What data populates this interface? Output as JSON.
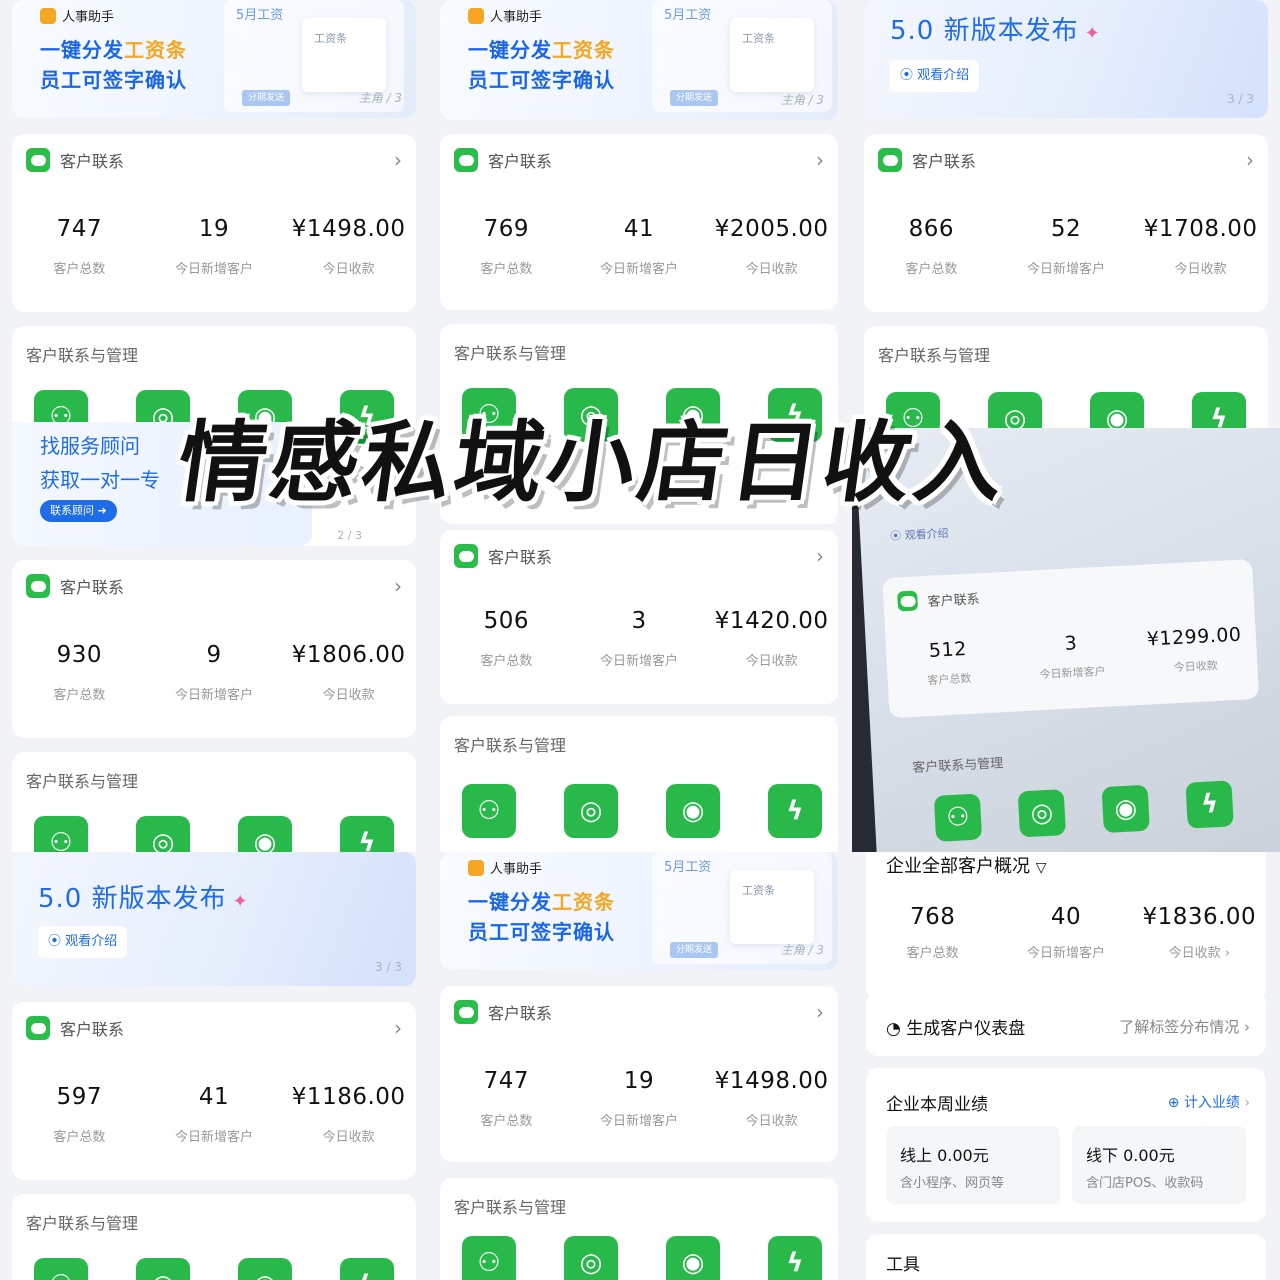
{
  "overlay": {
    "title": "情感私域小店日收入"
  },
  "labels": {
    "customer_link": "客户联系",
    "customer_mgmt": "客户联系与管理",
    "total": "客户总数",
    "new_today": "今日新增客户",
    "revenue_today": "今日收款"
  },
  "hr_banner": {
    "tag": "人事助手",
    "line1_a": "一键分发",
    "line1_b": "工资条",
    "line2": "员工可签字确认",
    "may_salary": "5月工资",
    "slip": "工资条",
    "send_btn": "分期发送",
    "page": "主角 / 3"
  },
  "v5_banner": {
    "title": "5.0 新版本发布",
    "sparkle": "✦",
    "watch": "观看介绍",
    "page": "3 / 3"
  },
  "advisor_banner": {
    "line1": "找服务顾问",
    "line2": "获取一对一专",
    "btn": "联系顾问",
    "page": "2 / 3"
  },
  "cards": {
    "c1": {
      "total": "747",
      "new": "19",
      "rev": "¥1498.00"
    },
    "c2": {
      "total": "769",
      "new": "41",
      "rev": "¥2005.00"
    },
    "c3": {
      "total": "866",
      "new": "52",
      "rev": "¥1708.00"
    },
    "c4": {
      "total": "930",
      "new": "9",
      "rev": "¥1806.00"
    },
    "c5": {
      "total": "506",
      "new": "3",
      "rev": "¥1420.00"
    },
    "c6": {
      "total": "512",
      "new": "3",
      "rev": "¥1299.00"
    },
    "c7": {
      "total": "597",
      "new": "41",
      "rev": "¥1186.00"
    },
    "c8": {
      "total": "747",
      "new": "19",
      "rev": "¥1498.00"
    },
    "c9": {
      "total": "768",
      "new": "40",
      "rev": "¥1836.00"
    }
  },
  "mgmt_icons": [
    "客户群",
    "客户朋友圈",
    "微信客服",
    "获客助手"
  ],
  "enterprise": {
    "overview_title": "企业全部客户概况",
    "revenue_link": "今日收款 ›",
    "dashboard": "生成客户仪表盘",
    "tag_dist": "了解标签分布情况",
    "weekly_title": "企业本周业绩",
    "record_perf": "计入业绩",
    "online_title": "线上 0.00元",
    "online_sub": "含小程序、网页等",
    "offline_title": "线下 0.00元",
    "offline_sub": "含门店POS、收款码",
    "tools": "工具"
  },
  "colors": {
    "brand_blue": "#1f6ce8",
    "wechat_green": "#2bbd4a",
    "accent_orange": "#f5a623"
  }
}
